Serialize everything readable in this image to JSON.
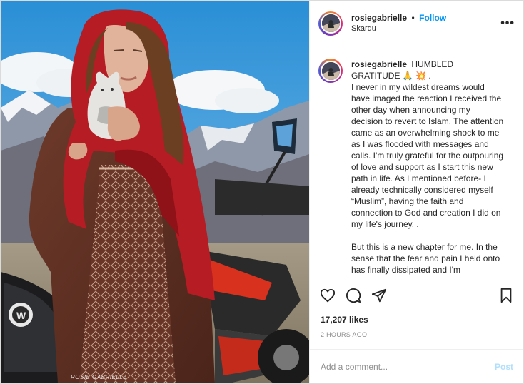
{
  "post": {
    "username": "rosiegabrielle",
    "follow_label": "Follow",
    "separator": "•",
    "location": "Skardu",
    "more_label": "•••",
    "watermark": "ROSIE GABRIELLE",
    "caption": {
      "username": "rosiegabrielle",
      "paragraphs": [
        "HUMBLED GRATITUDE 🙏 💥 .",
        "I never in my wildest dreams would have imaged the reaction I received the other day when announcing my decision to revert to Islam. The attention came as an overwhelming shock to me as I was flooded with messages and calls. I'm truly grateful for the outpouring of love and support as I start this new path in life. As I mentioned before- I already technically considered myself “Muslim”, having the faith and connection to God and creation I did on my life's journey. .",
        "But this is a new chapter for me. In the sense that the fear and pain I held onto has finally dissipated and I'm"
      ]
    },
    "likes": "17,207 likes",
    "time_ago": "2 HOURS AGO",
    "comment_placeholder": "Add a comment...",
    "post_label": "Post",
    "icons": [
      "heart-icon",
      "comment-icon",
      "share-icon",
      "bookmark-icon",
      "more-options-icon"
    ],
    "colors": {
      "link": "#0095f6",
      "post_disabled": "#b2dffc",
      "muted": "#8e8e8e",
      "text": "#262626"
    }
  }
}
